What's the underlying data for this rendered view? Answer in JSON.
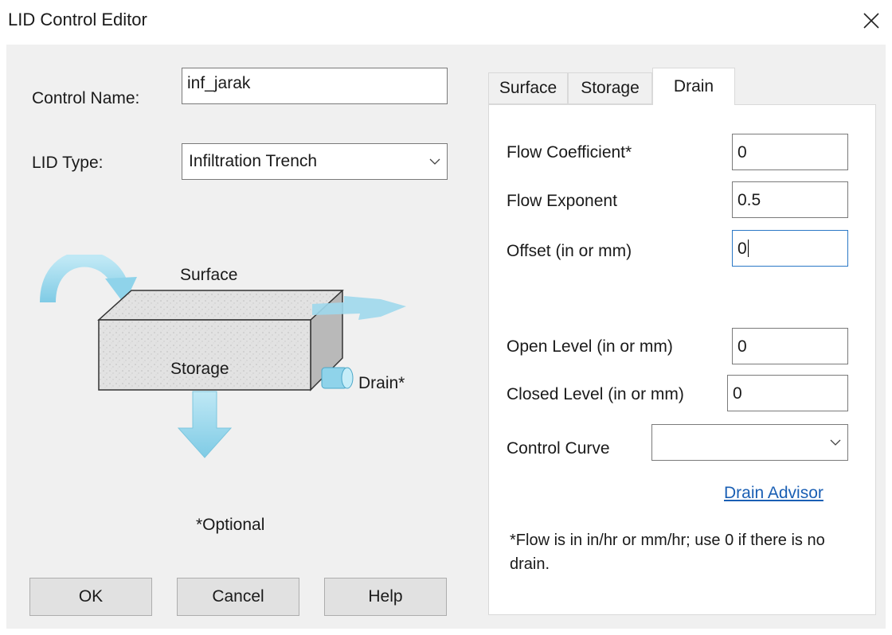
{
  "window": {
    "title": "LID Control Editor",
    "close_icon": "close-icon"
  },
  "form": {
    "control_name_label": "Control Name:",
    "control_name_value": "inf_jarak",
    "lid_type_label": "LID Type:",
    "lid_type_value": "Infiltration Trench"
  },
  "diagram": {
    "surface_label": "Surface",
    "storage_label": "Storage",
    "drain_label": "Drain*",
    "optional_note": "*Optional",
    "arrow_color": "#8fd3ea",
    "box_color": "#dcdcdc"
  },
  "buttons": {
    "ok": "OK",
    "cancel": "Cancel",
    "help": "Help"
  },
  "tabs": [
    {
      "label": "Surface",
      "active": false
    },
    {
      "label": "Storage",
      "active": false
    },
    {
      "label": "Drain",
      "active": true
    }
  ],
  "drain": {
    "flow_coefficient_label": "Flow Coefficient*",
    "flow_coefficient_value": "0",
    "flow_exponent_label": "Flow Exponent",
    "flow_exponent_value": "0.5",
    "offset_label": "Offset (in or mm)",
    "offset_value": "0",
    "open_level_label": "Open Level (in or mm)",
    "open_level_value": "0",
    "closed_level_label": "Closed Level (in or mm)",
    "closed_level_value": "0",
    "control_curve_label": "Control Curve",
    "control_curve_value": "",
    "drain_advisor_link": "Drain Advisor",
    "flow_note": "*Flow is in in/hr or mm/hr; use 0 if there is no drain."
  },
  "colors": {
    "link": "#1a5fb4",
    "focus_border": "#2b78c6",
    "dialog_bg": "#f0f0f0"
  }
}
